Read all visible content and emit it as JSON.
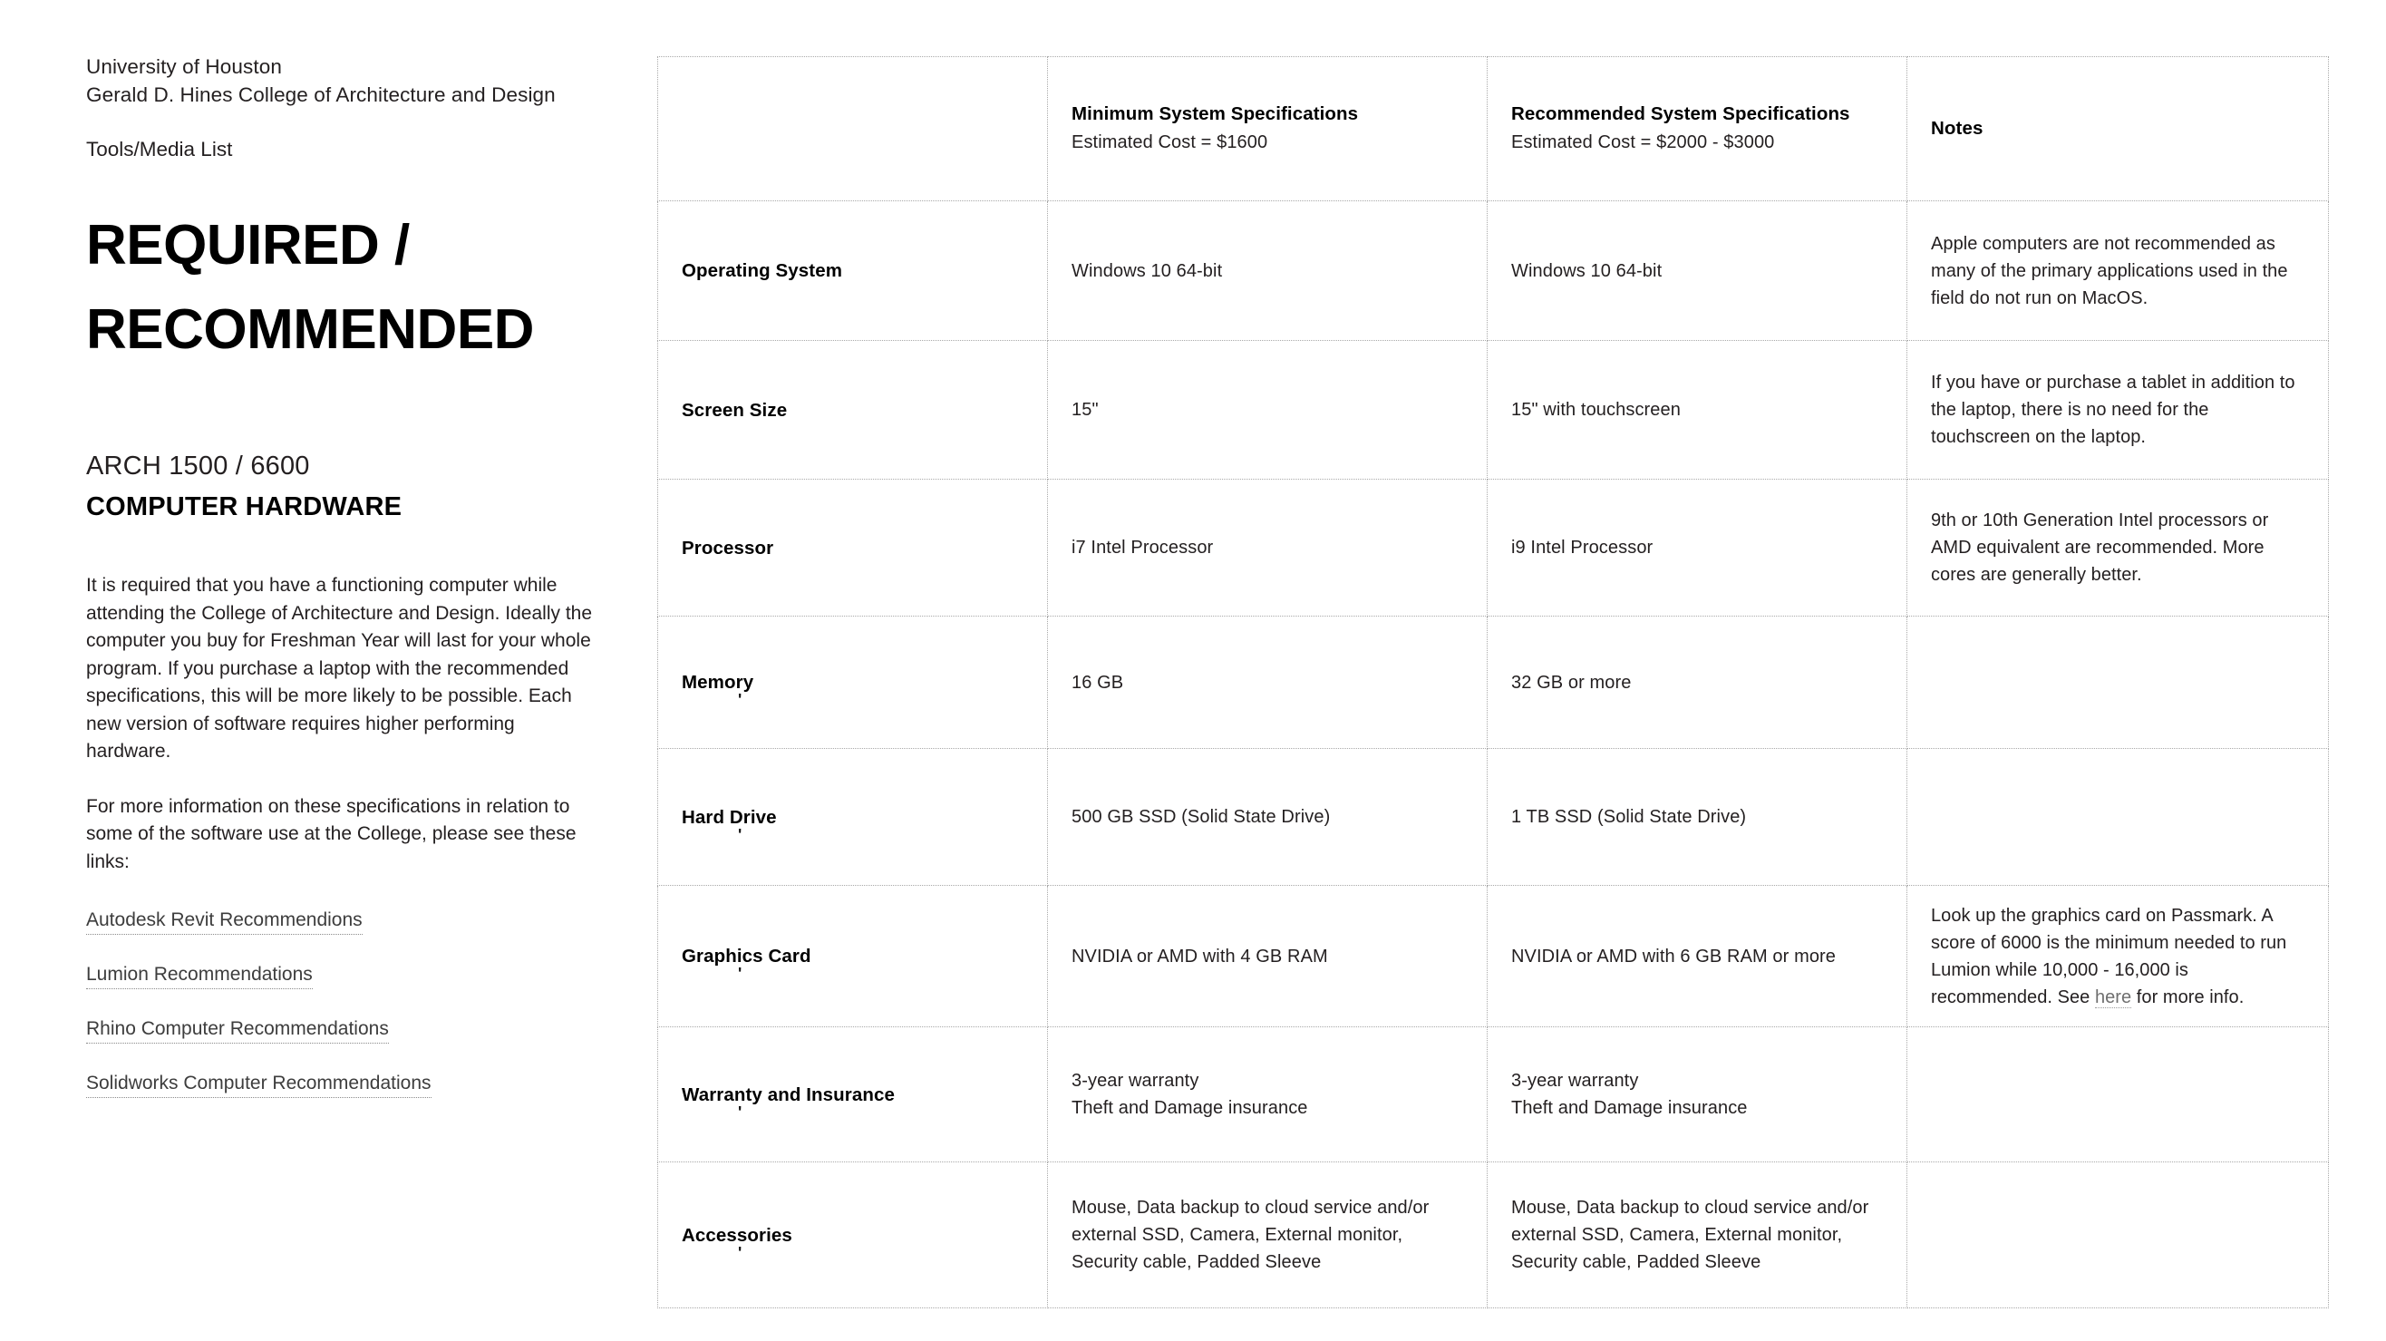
{
  "left": {
    "org_line1": "University of Houston",
    "org_line2": "Gerald D. Hines College of Architecture and Design",
    "tools_media": "Tools/Media List",
    "title_line1": "REQUIRED /",
    "title_line2": "RECOMMENDED",
    "course_code": "ARCH 1500 / 6600",
    "course_name": "COMPUTER HARDWARE",
    "paragraph1": "It is required that you have a functioning computer while attending the College of Architecture and Design. Ideally the computer you buy for Freshman Year will last for your whole program. If you purchase a laptop with the recommended specifications, this will be more likely to be possible. Each new version of software requires higher performing hardware.",
    "paragraph2": "For more information on these specifications in relation to some of the software use at the College, please see these links:",
    "links": [
      "Autodesk Revit Recommendions",
      "Lumion Recommendations",
      "Rhino Computer Recommendations",
      "Solidworks Computer Recommendations"
    ]
  },
  "table": {
    "header": {
      "label_col": "",
      "minimum_title": "Minimum System Specifications",
      "minimum_sub": "Estimated Cost = $1600",
      "recommended_title": "Recommended System Specifications",
      "recommended_sub": "Estimated Cost = $2000 - $3000",
      "notes_title": "Notes"
    },
    "rows": [
      {
        "label": "Operating System",
        "artifact": "",
        "minimum": "Windows 10 64-bit",
        "recommended": "Windows 10 64-bit",
        "notes": "Apple computers are not recommended as many of the primary applications used in the field do not run on MacOS."
      },
      {
        "label": "Screen Size",
        "artifact": "",
        "minimum": "15\"",
        "recommended": "15\" with touchscreen",
        "notes": "If you have or purchase a tablet in addition to the laptop, there is no need for the touchscreen on the laptop."
      },
      {
        "label": "Processor",
        "artifact": "",
        "minimum": "i7 Intel Processor",
        "recommended": "i9 Intel Processor",
        "notes": "9th or 10th Generation Intel processors or AMD equivalent  are recommended. More cores are generally better."
      },
      {
        "label": "Memory",
        "artifact": "'",
        "minimum": "16 GB",
        "recommended": "32 GB or more",
        "notes": ""
      },
      {
        "label": "Hard Drive",
        "artifact": "'",
        "minimum": "500 GB SSD (Solid State Drive)",
        "recommended": "1 TB SSD (Solid State Drive)",
        "notes": ""
      },
      {
        "label": "Graphics Card",
        "artifact": "'",
        "minimum": "NVIDIA or AMD with 4 GB RAM",
        "recommended": "NVIDIA or AMD with 6 GB RAM or more",
        "notes_pre": "Look up the graphics card on Passmark. A score of 6000 is the minimum needed to run Lumion while 10,000 - 16,000 is recommended. See ",
        "notes_link": "here",
        "notes_post": " for more info."
      },
      {
        "label": "Warranty and Insurance",
        "artifact": "'",
        "minimum": "3-year warranty\nTheft and Damage insurance",
        "recommended": "3-year warranty\nTheft and Damage insurance",
        "notes": ""
      },
      {
        "label": "Accessories",
        "artifact": "'",
        "minimum": "Mouse, Data backup to cloud service and/or external SSD, Camera, External monitor, Security cable, Padded Sleeve",
        "recommended": "Mouse, Data backup to cloud service and/or external SSD, Camera, External monitor, Security cable, Padded Sleeve",
        "notes": ""
      }
    ]
  }
}
